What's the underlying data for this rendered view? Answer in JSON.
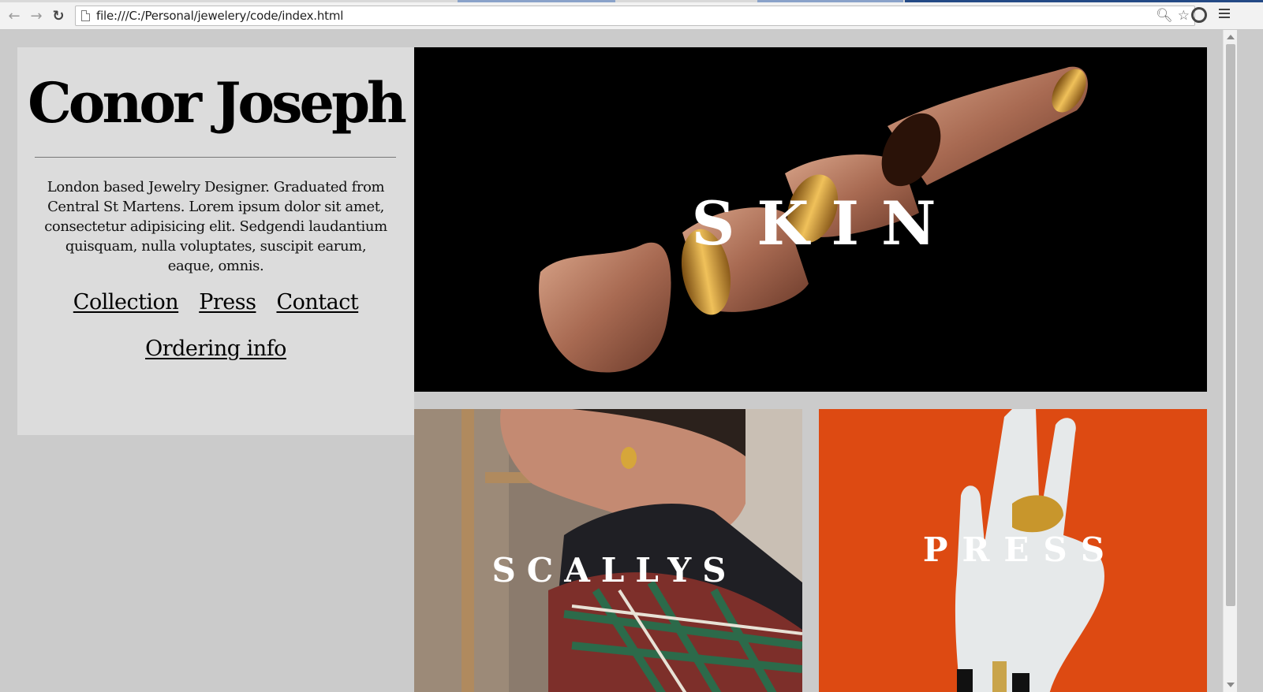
{
  "browser": {
    "url": "file:///C:/Personal/jewelery/code/index.html",
    "icons": [
      "back-arrow-icon",
      "forward-arrow-icon",
      "reload-icon",
      "page-icon",
      "zoom-icon",
      "star-icon",
      "extension-icon",
      "menu-icon"
    ]
  },
  "intro": {
    "name": "Conor Joseph",
    "bio": "London based Jewelry Designer. Graduated from Central St Martens. Lorem ipsum dolor sit amet, consectetur adipisicing elit. Sedgendi laudantium quisquam, nulla voluptates, suscipit earum, eaque, omnis.",
    "nav": {
      "collection": "Collection",
      "press": "Press",
      "contact": "Contact",
      "ordering": "Ordering info"
    }
  },
  "tiles": {
    "skin": "SKIN",
    "scallys": "SCALLYS",
    "press": "PRESS"
  },
  "colors": {
    "page_bg": "#cbcbcb",
    "panel_bg": "#dcdcdc",
    "press_bg": "#dd4a12",
    "skin_bg": "#000000"
  }
}
